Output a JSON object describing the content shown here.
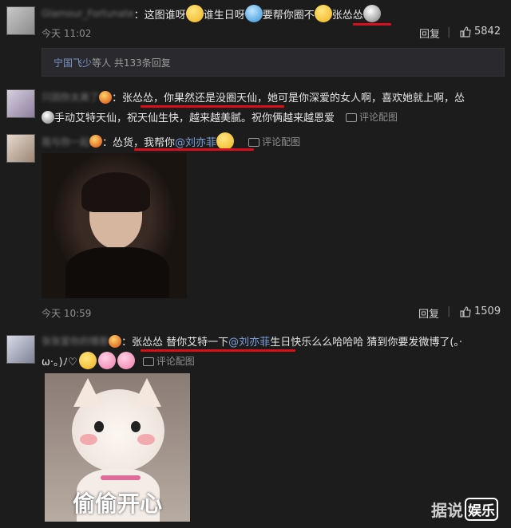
{
  "comment1": {
    "text": "：这图谁呀",
    "text2": " 谁生日呀",
    "text3": " 要帮你圈不",
    "mention": " 张怂怂",
    "time": "今天 11:02",
    "reply_label": "回复",
    "likes": "5842"
  },
  "replies_summary": {
    "names": "宁国飞少",
    "text": " 等人 共133条回复"
  },
  "comment2": {
    "line1_prefix": "：",
    "line1_underlined": "张怂怂，你果然还是没圈天仙",
    "line1_rest": "，她可是你深爱的女人啊，喜欢她就上啊，怂",
    "line2": "手动艾特天仙，祝天仙生快，越来越美腻。祝你俩越来越恩爱",
    "pic_comment": "评论配图"
  },
  "comment3": {
    "prefix": "：",
    "text": "怂货，我帮你",
    "mention": "@刘亦菲",
    "pic_comment": "评论配图",
    "time": "今天 10:59",
    "reply_label": "回复",
    "likes": "1509"
  },
  "comment4": {
    "prefix": "：",
    "text_a": "张怂怂 替你艾特一下",
    "mention": "@刘亦菲",
    "text_b": " 生日快乐么么哈哈哈 猜到你要发微博了(。·",
    "line2": "ω·。)ﾉ♡",
    "pic_comment": "评论配图",
    "cat_caption": "偷偷开心"
  },
  "watermark": {
    "left": "据说",
    "right": "娱乐"
  }
}
